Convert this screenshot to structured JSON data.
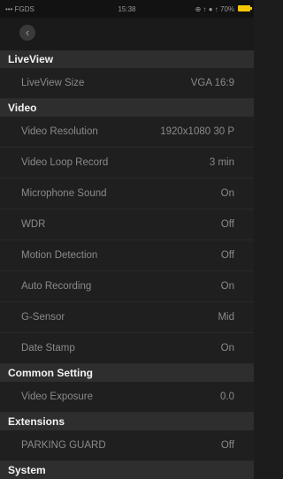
{
  "status_bar": {
    "left": "••• FGDS",
    "time": "15:38",
    "right": "⊕ ↑ ● ↑ 70%"
  },
  "nav": {
    "back_icon": "chevron-left-icon"
  },
  "sections": {
    "liveview": {
      "title": "LiveView",
      "rows": [
        {
          "label": "LiveView Size",
          "value": "VGA 16:9"
        }
      ]
    },
    "video": {
      "title": "Video",
      "rows": [
        {
          "label": "Video Resolution",
          "value": "1920x1080 30 P"
        },
        {
          "label": "Video Loop Record",
          "value": "3 min"
        },
        {
          "label": "Microphone Sound",
          "value": "On"
        },
        {
          "label": "WDR",
          "value": "Off"
        },
        {
          "label": "Motion Detection",
          "value": "Off"
        },
        {
          "label": "Auto Recording",
          "value": "On"
        },
        {
          "label": "G-Sensor",
          "value": "Mid"
        },
        {
          "label": "Date Stamp",
          "value": "On"
        }
      ]
    },
    "common": {
      "title": "Common Setting",
      "rows": [
        {
          "label": "Video Exposure",
          "value": "0.0"
        }
      ]
    },
    "extensions": {
      "title": "Extensions",
      "rows": [
        {
          "label": "PARKING GUARD",
          "value": "Off"
        }
      ]
    },
    "system": {
      "title": "System"
    }
  },
  "colors": {
    "battery": "#f3c800",
    "header_bg": "#2e2e2e",
    "row_bg": "#1f1f1f"
  }
}
